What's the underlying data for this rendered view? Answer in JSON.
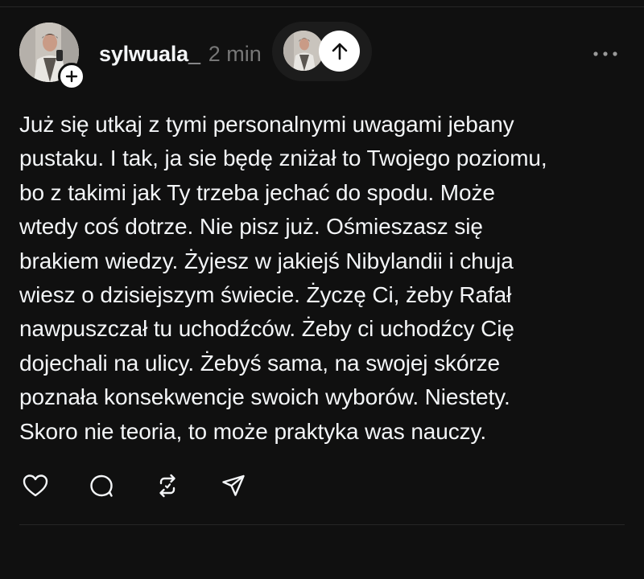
{
  "post": {
    "username": "sylwuala_",
    "time": "2 min",
    "text": "Już się utkaj z tymi personalnymi uwagami jebany\npustaku. I tak, ja sie będę zniżał to Twojego poziomu,\nbo z takimi jak Ty trzeba jechać do spodu. Może\nwtedy coś dotrze. Nie pisz już. Ośmieszasz się\nbrakiem wiedzy. Żyjesz w jakiejś Nibylandii i chuja\nwiesz o dzisiejszym świecie. Życzę Ci, żeby Rafał\nnawpuszczał tu uchodźców. Żeby ci uchodźcy Cię\ndojechali na ulicy. Żebyś sama, na swojej skórze\npoznała konsekwencje swoich wyborów. Niestety.\nSkoro nie teoria, to może praktyka was nauczy."
  },
  "icons": {
    "avatar": "user-photo",
    "follow": "plus-icon",
    "scroll_up": "arrow-up-icon",
    "more": "more-horizontal-icon",
    "like": "heart-icon",
    "reply": "comment-icon",
    "repost": "repost-icon",
    "share": "send-icon"
  },
  "colors": {
    "background": "#101010",
    "text": "#f3f5f7",
    "secondary_text": "#777777",
    "divider": "#262626",
    "pill": "#1c1c1c"
  }
}
